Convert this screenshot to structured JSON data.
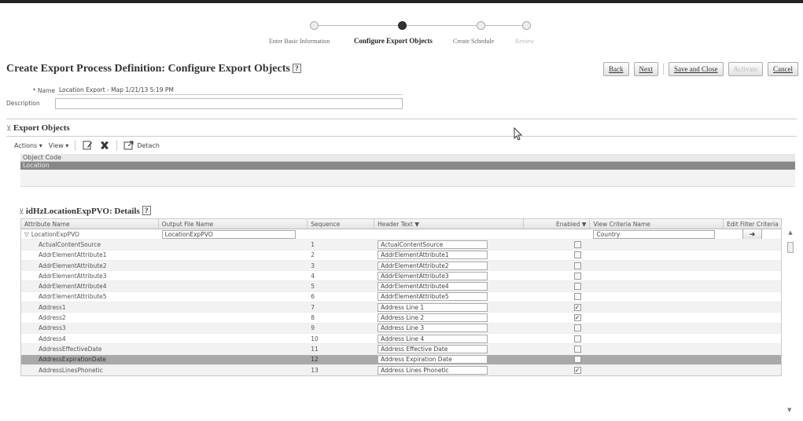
{
  "train": {
    "steps": [
      {
        "label": "Enter Basic Information"
      },
      {
        "label": "Configure Export Objects"
      },
      {
        "label": "Create Schedule"
      },
      {
        "label": "Review"
      }
    ]
  },
  "page": {
    "title": "Create Export Process Definition: Configure Export Objects",
    "help": "?"
  },
  "buttons": {
    "back": "Back",
    "next": "Next",
    "save_close": "Save and Close",
    "activate": "Activate",
    "cancel": "Cancel"
  },
  "form": {
    "name_label": "* Name",
    "name_value": "Location Export - Map 1/21/13 5:19 PM",
    "description_label": "Description",
    "description_value": ""
  },
  "export_objects": {
    "title": "Export Objects",
    "toolbar": {
      "actions": "Actions ▾",
      "view": "View ▾",
      "detach": "Detach"
    },
    "header": "Object Code",
    "rows": [
      "Location"
    ]
  },
  "details": {
    "title": "idHzLocationExpPVO: Details",
    "help": "?",
    "columns": [
      "Attribute Name",
      "Output File Name",
      "Sequence",
      "Header Text ▼",
      "Enabled ▼",
      "View Criteria Name",
      "Edit Filter Criteria"
    ],
    "root": {
      "attribute": "LocationExpPVO",
      "output_file": "LocationExpPVO",
      "criteria": "Country"
    },
    "rows": [
      {
        "attribute": "ActualContentSource",
        "sequence": "1",
        "header": "ActualContentSource",
        "enabled": false
      },
      {
        "attribute": "AddrElementAttribute1",
        "sequence": "2",
        "header": "AddrElementAttribute1",
        "enabled": false
      },
      {
        "attribute": "AddrElementAttribute2",
        "sequence": "3",
        "header": "AddrElementAttribute2",
        "enabled": false
      },
      {
        "attribute": "AddrElementAttribute3",
        "sequence": "4",
        "header": "AddrElementAttribute3",
        "enabled": false
      },
      {
        "attribute": "AddrElementAttribute4",
        "sequence": "5",
        "header": "AddrElementAttribute4",
        "enabled": false
      },
      {
        "attribute": "AddrElementAttribute5",
        "sequence": "6",
        "header": "AddrElementAttribute5",
        "enabled": false
      },
      {
        "attribute": "Address1",
        "sequence": "7",
        "header": "Address Line 1",
        "enabled": true
      },
      {
        "attribute": "Address2",
        "sequence": "8",
        "header": "Address Line 2",
        "enabled": true
      },
      {
        "attribute": "Address3",
        "sequence": "9",
        "header": "Address Line 3",
        "enabled": false
      },
      {
        "attribute": "Address4",
        "sequence": "10",
        "header": "Address Line 4",
        "enabled": false
      },
      {
        "attribute": "AddressEffectiveDate",
        "sequence": "11",
        "header": "Address Effective Date",
        "enabled": false
      },
      {
        "attribute": "AddressExpirationDate",
        "sequence": "12",
        "header": "Address Expiration Date",
        "enabled": false
      },
      {
        "attribute": "AddressLinesPhonetic",
        "sequence": "13",
        "header": "Address Lines Phonetic",
        "enabled": true
      }
    ]
  }
}
